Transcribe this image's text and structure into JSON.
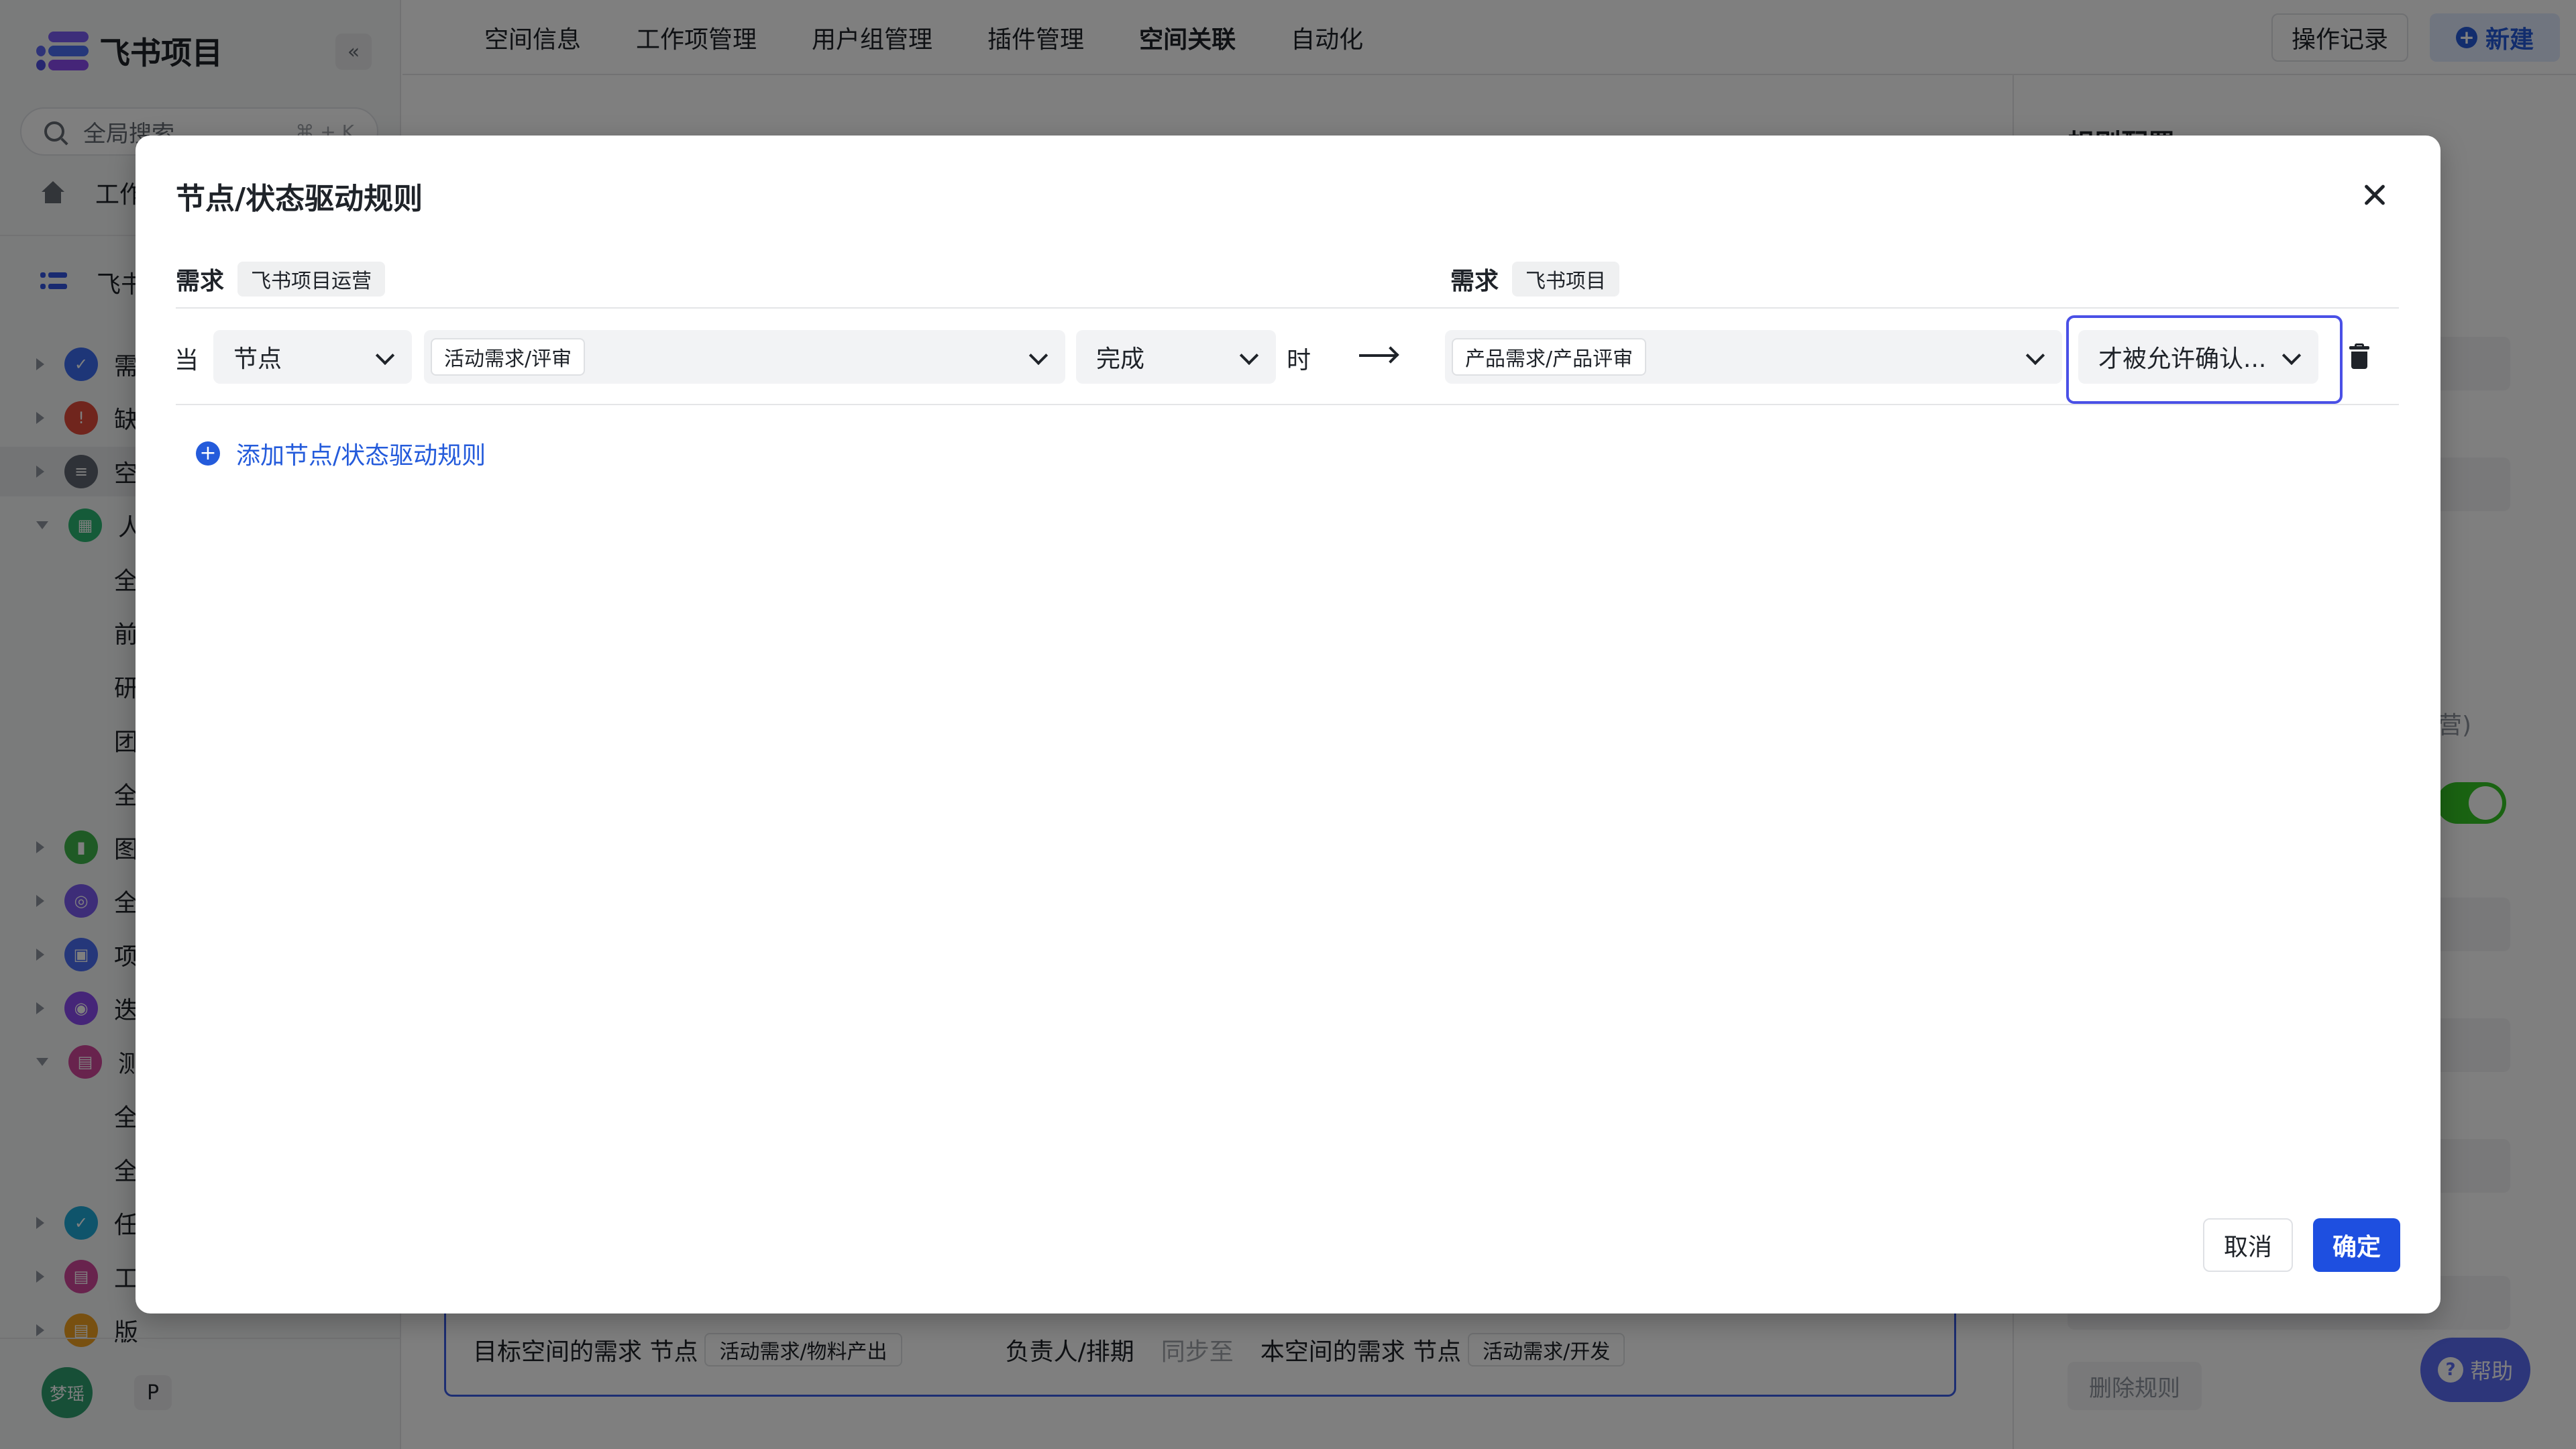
{
  "app": {
    "logo_text": "飞书项目",
    "collapse_glyph": "«"
  },
  "search": {
    "label": "全局搜索",
    "shortcut": "⌘ + K"
  },
  "sidebar": {
    "workbench_label": "工作",
    "space_label": "飞书",
    "tree": [
      {
        "label": "需",
        "color": "#3d6cf0",
        "glyph": "✓",
        "expanded": false
      },
      {
        "label": "缺",
        "color": "#e04a3b",
        "glyph": "!",
        "expanded": false
      },
      {
        "label": "空",
        "color": "#5f6570",
        "glyph": "≡",
        "expanded": false,
        "active": true
      },
      {
        "label": "人",
        "color": "#2bb673",
        "glyph": "▦",
        "expanded": true
      },
      {
        "label": "图",
        "color": "#3fb44b",
        "glyph": "▮",
        "expanded": false
      },
      {
        "label": "全",
        "color": "#7a5bf0",
        "glyph": "◎",
        "expanded": false
      },
      {
        "label": "项",
        "color": "#4b6ef5",
        "glyph": "▣",
        "expanded": false
      },
      {
        "label": "迭",
        "color": "#8a4bf0",
        "glyph": "◉",
        "expanded": false
      },
      {
        "label": "测",
        "color": "#d0479b",
        "glyph": "▤",
        "expanded": true
      },
      {
        "label": "任",
        "color": "#1fa9d6",
        "glyph": "✓",
        "expanded": false
      },
      {
        "label": "工",
        "color": "#d0479b",
        "glyph": "▤",
        "expanded": false
      },
      {
        "label": "版",
        "color": "#f0a020",
        "glyph": "▤",
        "expanded": false
      }
    ],
    "sub_items_people": [
      "全",
      "前",
      "研",
      "团",
      "全"
    ],
    "sub_items_test": [
      "全",
      "全"
    ],
    "avatar_text": "梦瑶",
    "p_badge": "P"
  },
  "topnav": {
    "tabs": [
      "空间信息",
      "工作项管理",
      "用户组管理",
      "插件管理",
      "空间关联",
      "自动化"
    ],
    "active_tab": "空间关联",
    "ops_label": "操作记录",
    "new_label": "新建"
  },
  "right_panel": {
    "title": "规则配置",
    "hint": "目运营)",
    "delete_rule": "删除规则"
  },
  "bg_rule": {
    "target_label": "目标空间的需求 节点",
    "target_tag": "活动需求/物料产出",
    "owner_label": "负责人/排期",
    "sync_label": "同步至",
    "local_label": "本空间的需求 节点",
    "local_tag": "活动需求/开发"
  },
  "help": {
    "label": "帮助"
  },
  "modal": {
    "title": "节点/状态驱动规则",
    "left_header": {
      "type": "需求",
      "space": "飞书项目运营"
    },
    "right_header": {
      "type": "需求",
      "space": "飞书项目"
    },
    "rule": {
      "when": "当",
      "trigger_type": "节点",
      "source_node": "活动需求/评审",
      "source_state": "完成",
      "when_suffix": "时",
      "target_node": "产品需求/产品评审",
      "action": "才被允许确认..."
    },
    "add_rule_label": "添加节点/状态驱动规则",
    "cancel_label": "取消",
    "ok_label": "确定"
  }
}
